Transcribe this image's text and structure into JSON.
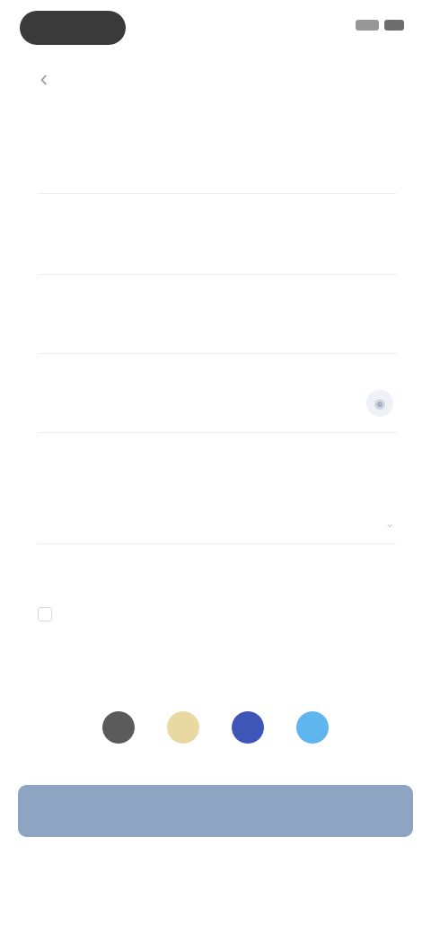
{
  "status_bar": {
    "signal_icon": "signal-icon",
    "battery_icon": "battery-icon"
  },
  "header": {
    "title": "",
    "back_icon": "chevron-left-icon"
  },
  "form": {
    "fields": [
      {
        "label": ""
      },
      {
        "label": ""
      },
      {
        "label": ""
      },
      {
        "label": ""
      }
    ],
    "password_toggle_icon": "eye-icon",
    "hint": "",
    "dropdown_value": "",
    "dropdown_icon": "chevron-down-icon",
    "link_line": "",
    "agree_text": ""
  },
  "social": {
    "divider_text": "",
    "buttons": [
      {
        "icon": "social-icon-1",
        "color": "#5b5b5b"
      },
      {
        "icon": "social-icon-2",
        "color": "#e8d9a0"
      },
      {
        "icon": "social-icon-3",
        "color": "#3d56b8"
      },
      {
        "icon": "social-icon-4",
        "color": "#5fb6ef"
      }
    ]
  },
  "actions": {
    "primary_label": "",
    "footer_link": ""
  },
  "colors": {
    "primary_button": "#8fa4c2",
    "link": "#a7b9d6"
  }
}
